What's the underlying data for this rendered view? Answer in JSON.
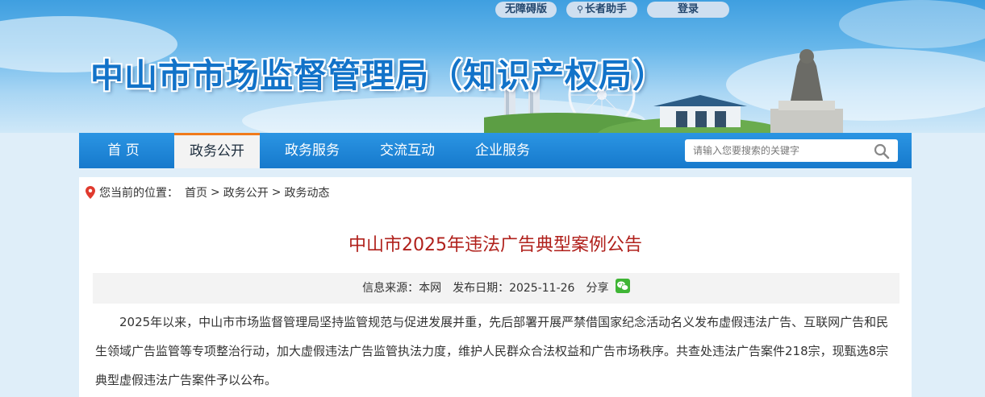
{
  "top_buttons": {
    "accessibility": "无障碍版",
    "elder_helper": "长者助手",
    "login": "登录"
  },
  "site_title": "中山市市场监督管理局（知识产权局）",
  "nav": {
    "items": [
      "首 页",
      "政务公开",
      "政务服务",
      "交流互动",
      "企业服务"
    ],
    "active_index": 1
  },
  "search": {
    "placeholder": "请输入您要搜索的关键字"
  },
  "breadcrumb": {
    "prefix": "您当前的位置：",
    "home": "首页",
    "sep1": ">",
    "level1": "政务公开",
    "sep2": ">",
    "level2": "政务动态"
  },
  "article": {
    "title": "中山市2025年违法广告典型案例公告",
    "source": "信息来源：本网",
    "date": "发布日期：2025-11-26",
    "share": "分享",
    "body": "2025年以来，中山市市场监督管理局坚持监管规范与促进发展并重，先后部署开展严禁借国家纪念活动名义发布虚假违法广告、互联网广告和民生领域广告监管等专项整治行动，加大虚假违法广告监管执法力度，维护人民群众合法权益和广告市场秩序。共查处违法广告案件218宗，现甄选8宗典型虚假违法广告案件予以公布。"
  },
  "colors": {
    "nav_blue": "#1f87d8",
    "accent_orange": "#f07a1b",
    "title_red": "#b0201b",
    "site_title_blue": "#1273c9"
  }
}
